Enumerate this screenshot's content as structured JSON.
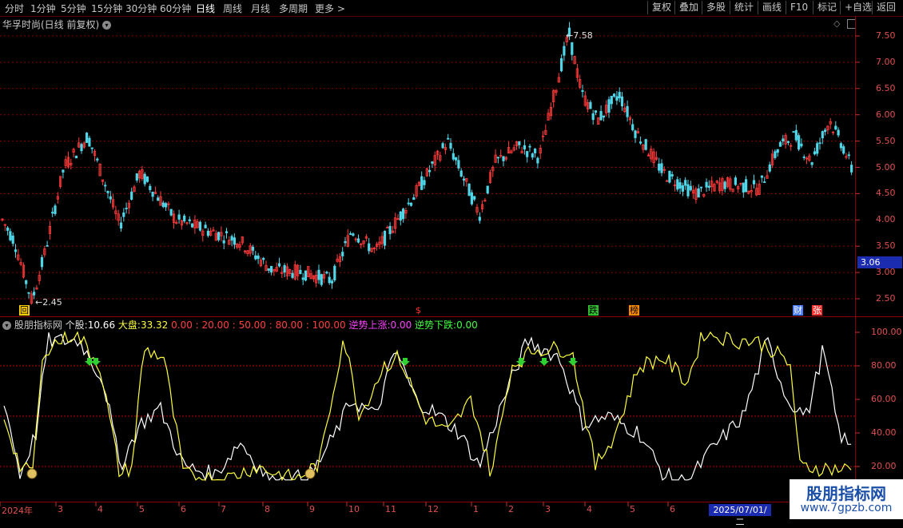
{
  "toolbar": {
    "periods": [
      "分时",
      "1分钟",
      "5分钟",
      "15分钟",
      "30分钟",
      "60分钟",
      "日线",
      "周线",
      "月线",
      "多周期",
      "更多 >"
    ],
    "active_period": "日线",
    "right_buttons": [
      "复权",
      "叠加",
      "多股",
      "统计",
      "画线",
      "F10",
      "标记",
      "+自选",
      "返回"
    ]
  },
  "main_chart": {
    "title": "华孚时尚(日线 前复权)",
    "high_label": "7.58",
    "low_label": "2.45",
    "current_price_tag": "3.06",
    "price_ticks": [
      "7.50",
      "7.00",
      "6.50",
      "6.00",
      "5.50",
      "5.00",
      "4.50",
      "4.00",
      "3.50",
      "3.00",
      "2.50"
    ],
    "badges": [
      {
        "text": "回",
        "color": "#ffd000"
      },
      {
        "text": "$",
        "color": "#ff3030"
      },
      {
        "text": "跌",
        "color": "#30c030"
      },
      {
        "text": "榜",
        "color": "#ff8c00"
      },
      {
        "text": "财",
        "color": "#4a7cff"
      },
      {
        "text": "张",
        "color": "#ff3030"
      }
    ],
    "colors": {
      "up": "#ff3a3a",
      "down": "#4fd6e8",
      "grid": "#8b0000"
    }
  },
  "indicator": {
    "name": "股朋指标网",
    "stock_label": "个股:",
    "stock_value": "10.66",
    "market_label": "大盘:",
    "market_value": "33.32",
    "levels": [
      "0.00",
      "20.00",
      "50.00",
      "80.00",
      "100.00"
    ],
    "up_label": "逆势上涨:",
    "up_value": "0.00",
    "down_label": "逆势下跌:",
    "down_value": "0.00",
    "y_ticks": [
      "100.00",
      "80.00",
      "60.00",
      "40.00",
      "20.00"
    ],
    "colors": {
      "stock": "#ffffff",
      "market": "#ffff40",
      "arrow": "#30d030",
      "up": "#ff40ff",
      "down": "#40ff40"
    }
  },
  "x_axis": {
    "labels": [
      "2024年",
      "3",
      "4",
      "5",
      "6",
      "7",
      "8",
      "9",
      "10",
      "11",
      "12",
      "1",
      "2",
      "3",
      "4",
      "5",
      "6"
    ],
    "cursor_date": "2025/07/01/二"
  },
  "watermark": {
    "line1": "股朋指标网",
    "line2": "www.7gpzb.com"
  }
}
